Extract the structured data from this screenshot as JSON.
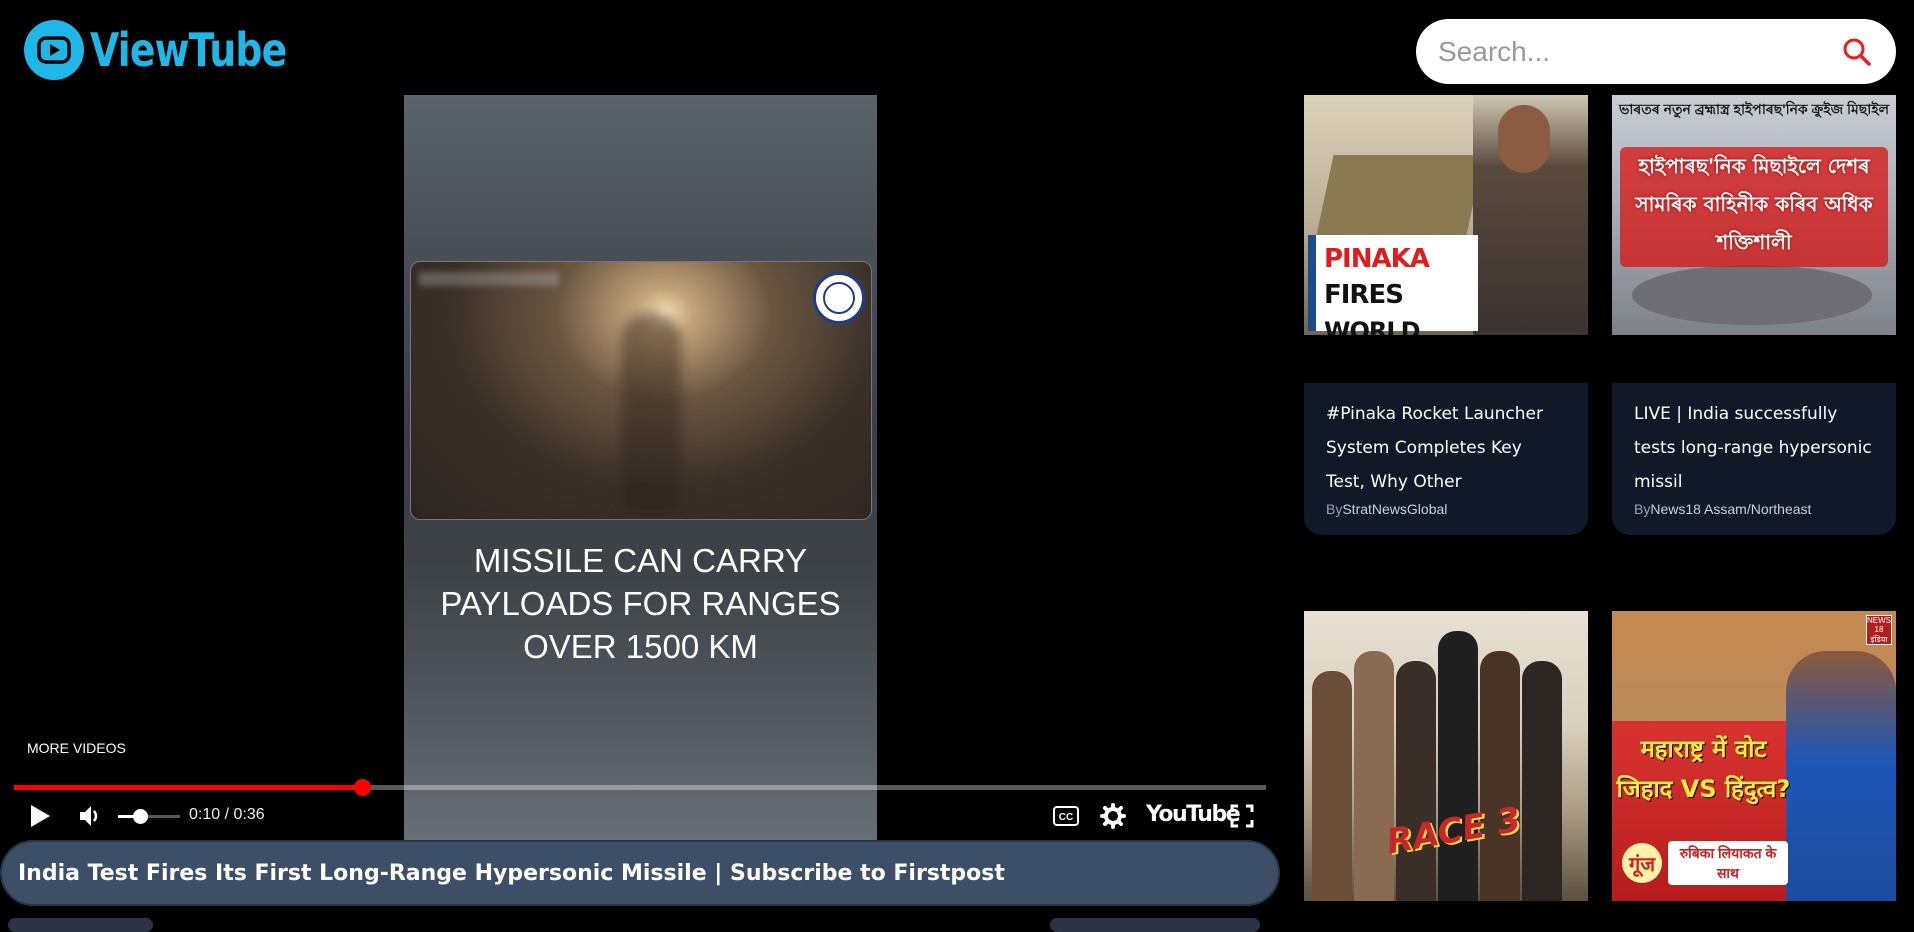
{
  "app": {
    "name": "ViewTube"
  },
  "search": {
    "placeholder": "Search..."
  },
  "player": {
    "clip_caption": "MISSILE CAN CARRY PAYLOADS FOR RANGES OVER 1500 KM",
    "more_videos_label": "MORE VIDEOS",
    "time_display": "0:10 / 0:36",
    "progress_fraction": 0.2778,
    "volume_fraction": 0.35,
    "brand_label": "YouTube"
  },
  "video": {
    "title": "India Test Fires Its First Long-Range Hypersonic Missile | Subscribe to Firstpost"
  },
  "recommendations": [
    {
      "title": "#Pinaka Rocket Launcher System Completes Key Test, Why Other",
      "author_prefix": "By",
      "author": "StratNewsGlobal",
      "thumb_text": {
        "line1_red": "PINAKA",
        "line1_black": "FIRES",
        "line2": "WORLD CRAVES"
      }
    },
    {
      "title": "LIVE | India successfully tests long-range hypersonic missil",
      "author_prefix": "By",
      "author": "News18 Assam/Northeast",
      "thumb_text": {
        "top": "ভাৰতৰ নতুন ব্ৰহ্মাস্ত্ৰ হাইপাৰছ'নিক ক্ৰুইজ মিছাইল",
        "band": "হাইপাৰছ'নিক মিছাইলে দেশৰ সামৰিক বাহিনীক কৰিব অধিক শক্তিশালী"
      }
    },
    {
      "thumb_text": {
        "logo": "RACE 3"
      }
    },
    {
      "thumb_text": {
        "headline": "महाराष्ट्र में वोट जिहाद VS हिंदुत्व?",
        "logo": "गूंज",
        "subline": "रुबिका लियाकत के साथ",
        "corner": "NEWS 18 इंडिया"
      }
    }
  ],
  "colors": {
    "accent": "#1fb6e8",
    "progress": "#ff0000",
    "title_bar": "#3d4f66",
    "card_bg": "#111827"
  }
}
